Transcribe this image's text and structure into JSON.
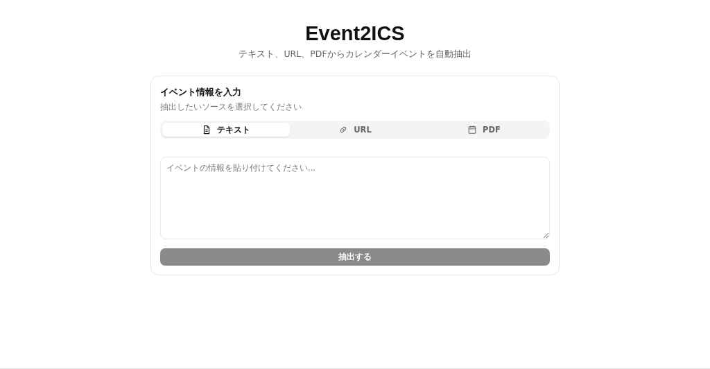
{
  "header": {
    "title": "Event2ICS",
    "subtitle": "テキスト、URL、PDFからカレンダーイベントを自動抽出"
  },
  "card": {
    "title": "イベント情報を入力",
    "description": "抽出したいソースを選択してください"
  },
  "tabs": [
    {
      "label": "テキスト",
      "kind": "document",
      "selected": true
    },
    {
      "label": "URL",
      "kind": "link",
      "selected": false
    },
    {
      "label": "PDF",
      "kind": "calendar",
      "selected": false
    }
  ],
  "input": {
    "placeholder": "イベントの情報を貼り付けてください..."
  },
  "submit": {
    "label": "抽出する",
    "disabled": true
  }
}
